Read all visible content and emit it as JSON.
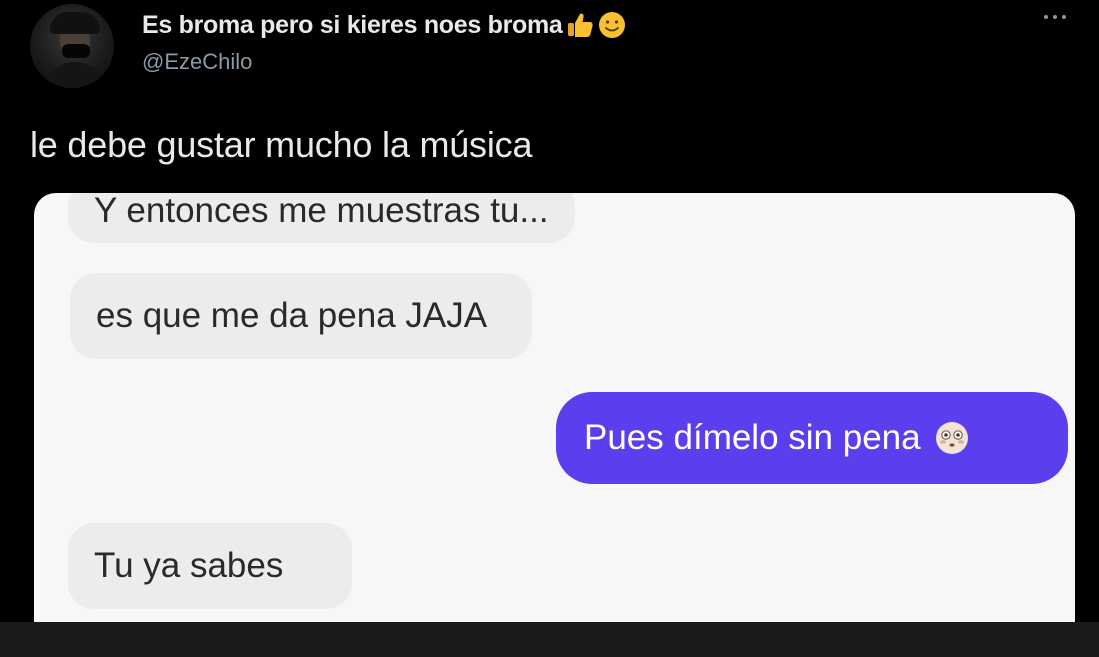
{
  "tweet": {
    "display_name": "Es broma pero si kieres noes broma",
    "handle": "@EzeChilo",
    "text": "le debe gustar mucho la música",
    "name_emojis": [
      "thumbs-up-icon",
      "smiling-face-icon"
    ]
  },
  "chat": {
    "messages": [
      {
        "side": "incoming",
        "text": "Y entonces me muestras tu..."
      },
      {
        "side": "incoming",
        "text": "es que me da pena JAJA"
      },
      {
        "side": "outgoing",
        "text": "Pues dímelo sin pena",
        "emoji": "flushed-face-icon"
      },
      {
        "side": "incoming",
        "text": "Tu ya sabes"
      }
    ]
  },
  "colors": {
    "background": "#000000",
    "outgoing_bubble": "#5b3fef",
    "incoming_bubble": "#ececee",
    "name_text": "#e7e9ea",
    "handle_text": "#8b98a5"
  }
}
